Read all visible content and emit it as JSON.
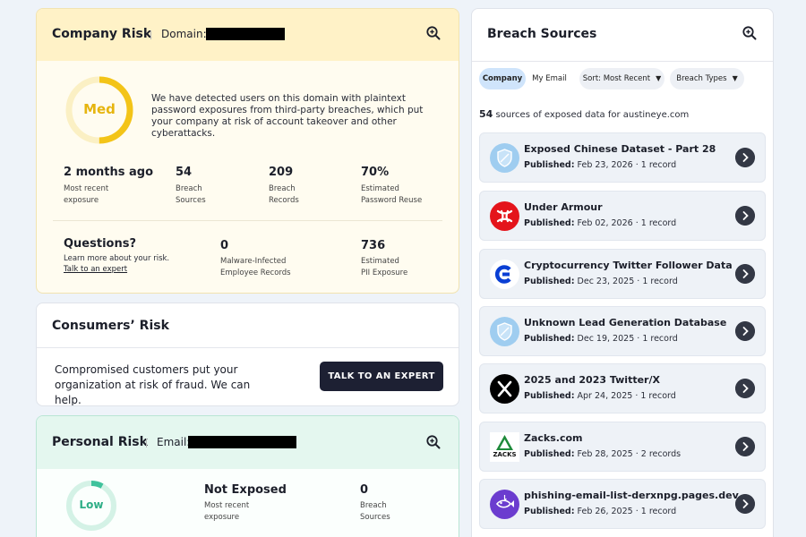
{
  "company": {
    "title": "Company Risk",
    "domain_label": "Domain:",
    "risk_level": "Med",
    "description": "We have detected users on this domain with plaintext password exposures from third-party breaches, which put your company at risk of account takeover and other cyberattacks.",
    "stats": [
      {
        "value": "2 months ago",
        "label1": "Most recent",
        "label2": "exposure"
      },
      {
        "value": "54",
        "label1": "Breach",
        "label2": "Sources"
      },
      {
        "value": "209",
        "label1": "Breach",
        "label2": "Records"
      },
      {
        "value": "70%",
        "label1": "Estimated",
        "label2": "Password Reuse"
      }
    ],
    "questions_title": "Questions?",
    "questions_text": "Learn more about your risk.",
    "questions_link": "Talk to an expert",
    "stats2": [
      {
        "value": "0",
        "label1": "Malware-Infected",
        "label2": "Employee Records"
      },
      {
        "value": "736",
        "label1": "Estimated",
        "label2": "PII Exposure"
      }
    ]
  },
  "consumers": {
    "title": "Consumers’ Risk",
    "text": "Compromised customers put your organization at risk of fraud. We can help.",
    "button": "TALK TO AN EXPERT"
  },
  "personal": {
    "title": "Personal Risk",
    "email_label": "Email:",
    "risk_level": "Low",
    "stats": [
      {
        "value": "Not Exposed",
        "label1": "Most recent",
        "label2": "exposure"
      },
      {
        "value": "0",
        "label1": "Breach",
        "label2": "Sources"
      }
    ]
  },
  "breach": {
    "title": "Breach Sources",
    "filters": {
      "company": "Company",
      "my_email": "My Email",
      "sort": "Sort: Most Recent",
      "types": "Breach Types"
    },
    "count": "54",
    "count_text": "sources of exposed data for austineye.com",
    "published_label": "Published:",
    "items": [
      {
        "title": "Exposed Chinese Dataset - Part 28",
        "date": "Feb 23, 2026",
        "records": "1 record",
        "logo": "shield-logo"
      },
      {
        "title": "Under Armour",
        "date": "Feb 02, 2026",
        "records": "1 record",
        "logo": "under-armour-logo"
      },
      {
        "title": "Cryptocurrency Twitter Follower Data",
        "date": "Dec 23, 2025",
        "records": "1 record",
        "logo": "crypto-logo"
      },
      {
        "title": "Unknown Lead Generation Database",
        "date": "Dec 19, 2025",
        "records": "1 record",
        "logo": "shield-logo"
      },
      {
        "title": "2025 and 2023 Twitter/X",
        "date": "Apr 24, 2025",
        "records": "1 record",
        "logo": "x-logo"
      },
      {
        "title": "Zacks.com",
        "date": "Feb 28, 2025",
        "records": "2 records",
        "logo": "zacks-logo",
        "logo_text": "ZACKS"
      },
      {
        "title": "phishing-email-list-derxnpg.pages.dev",
        "date": "Feb 26, 2025",
        "records": "1 record",
        "logo": "phishing-logo"
      }
    ]
  },
  "colors": {
    "med": "#f3c418",
    "low": "#3fc29c",
    "accent_dark": "#1d2033"
  }
}
